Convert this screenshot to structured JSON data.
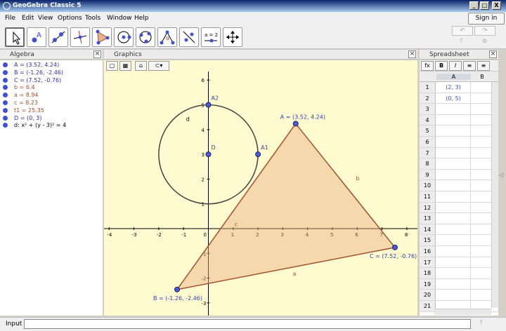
{
  "window": {
    "title": "GeoGebra Classic 5",
    "minimize": "_",
    "maximize": "□",
    "close": "X"
  },
  "menu": [
    "File",
    "Edit",
    "View",
    "Options",
    "Tools",
    "Window",
    "Help"
  ],
  "signin": "Sign in",
  "toolbar": {
    "tools": [
      "move-tool",
      "point-tool",
      "line-tool",
      "perpendicular-tool",
      "polygon-tool",
      "circle-tool",
      "conic-tool",
      "angle-tool",
      "reflect-tool",
      "slider-tool",
      "move-graphics-tool"
    ],
    "slider_label": "a = 2"
  },
  "algebra": {
    "title": "Algebra",
    "items": [
      {
        "text": "A = (3.52, 4.24)",
        "color": "#3030a0"
      },
      {
        "text": "B = (-1.26, -2.46)",
        "color": "#3030a0"
      },
      {
        "text": "C = (7.52, -0.76)",
        "color": "#3030a0"
      },
      {
        "text": "b = 6.4",
        "color": "#a0522d"
      },
      {
        "text": "a = 8.94",
        "color": "#a0522d"
      },
      {
        "text": "c = 8.23",
        "color": "#a0522d"
      },
      {
        "text": "t1 = 25.35",
        "color": "#a0522d"
      },
      {
        "text": "D = (0, 3)",
        "color": "#3030a0"
      },
      {
        "text": "d: x² + (y - 3)² = 4",
        "color": "#000000"
      }
    ]
  },
  "graphics": {
    "title": "Graphics",
    "x_ticks": [
      "-4",
      "-3",
      "-2",
      "-1",
      "0",
      "1",
      "2",
      "3",
      "4",
      "5",
      "6",
      "7",
      "8"
    ],
    "y_ticks": [
      "6",
      "5",
      "4",
      "3",
      "2",
      "1",
      "-1",
      "-2",
      "-3"
    ],
    "labels": {
      "A": "A = (3.52, 4.24)",
      "B": "B = (-1.26, -2.46)",
      "C": "C = (7.52, -0.76)",
      "A2": "A2",
      "A1": "A1",
      "D": "D",
      "d": "d",
      "a": "a",
      "b": "b",
      "c": "c"
    }
  },
  "spreadsheet": {
    "title": "Spreadsheet",
    "col_a": "A",
    "col_b": "B",
    "rows": [
      "1",
      "2",
      "3",
      "4",
      "5",
      "6",
      "7",
      "8",
      "9",
      "10",
      "11",
      "12",
      "13",
      "14",
      "15",
      "16",
      "17",
      "18",
      "19",
      "20",
      "21"
    ],
    "cells": {
      "1": "(2, 3)",
      "2": "(0, 5)"
    },
    "bold": "B",
    "italic": "I"
  },
  "input": {
    "label": "Input"
  }
}
